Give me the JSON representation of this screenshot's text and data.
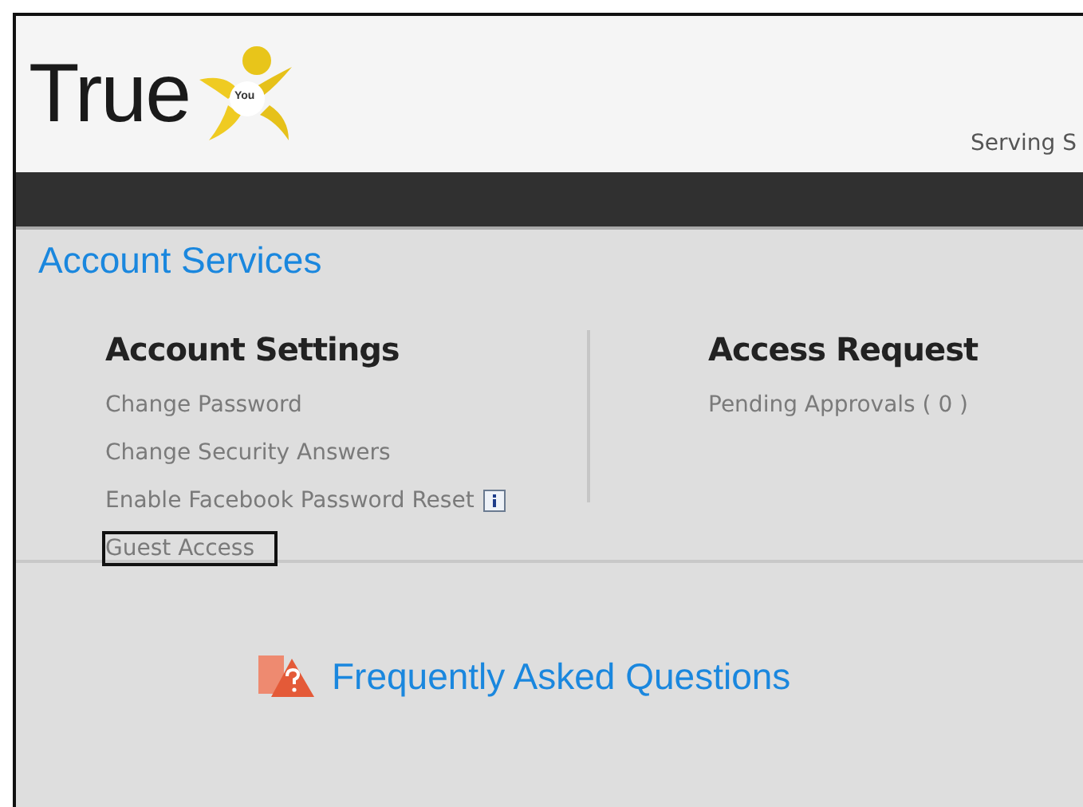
{
  "header": {
    "logo_text": "True",
    "logo_badge": "You",
    "tagline": "Serving S"
  },
  "page_title": "Account Services",
  "sections": [
    {
      "title": "Account Settings",
      "links": [
        {
          "label": "Change Password",
          "info": false,
          "highlighted": false
        },
        {
          "label": "Change Security Answers",
          "info": false,
          "highlighted": false
        },
        {
          "label": "Enable Facebook Password Reset",
          "info": true,
          "highlighted": false
        },
        {
          "label": "Guest Access",
          "info": false,
          "highlighted": true
        }
      ]
    },
    {
      "title": "Access Request",
      "links": [
        {
          "label": "Pending Approvals ( 0 )",
          "info": false,
          "highlighted": false
        }
      ]
    }
  ],
  "faq": {
    "label": "Frequently Asked Questions"
  }
}
